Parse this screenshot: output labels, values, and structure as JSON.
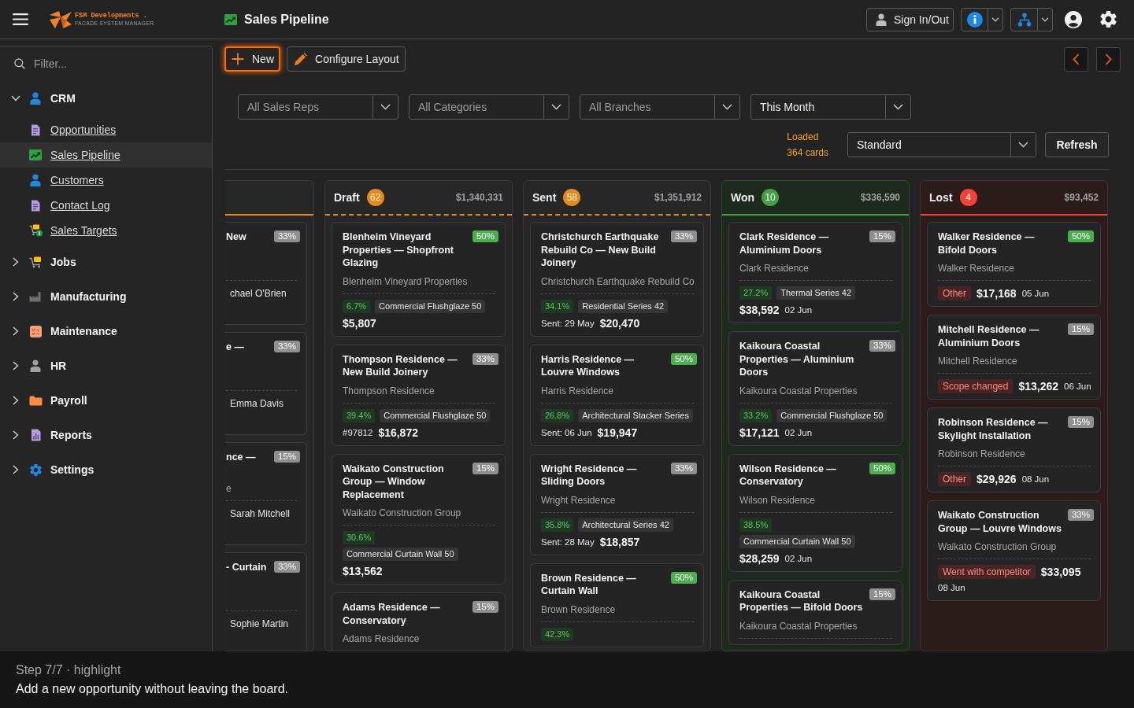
{
  "header": {
    "logo": {
      "name": "FSM Developments .",
      "tagline": "FACADE SYSTEM MANAGER"
    },
    "title": "Sales Pipeline",
    "sign_in_button": "Sign In/Out"
  },
  "sidebar": {
    "filter": {
      "placeholder": "Filter..."
    },
    "items": [
      {
        "label": "CRM",
        "expanded": true,
        "children": [
          {
            "label": "Opportunities",
            "selected": false
          },
          {
            "label": "Sales Pipeline",
            "selected": true
          },
          {
            "label": "Customers",
            "selected": false
          },
          {
            "label": "Contact Log",
            "selected": false
          },
          {
            "label": "Sales Targets",
            "selected": false
          }
        ]
      },
      {
        "label": "Jobs",
        "expanded": false
      },
      {
        "label": "Manufacturing",
        "expanded": false
      },
      {
        "label": "Maintenance",
        "expanded": false
      },
      {
        "label": "HR",
        "expanded": false
      },
      {
        "label": "Payroll",
        "expanded": false
      },
      {
        "label": "Reports",
        "expanded": false
      },
      {
        "label": "Settings",
        "expanded": false
      }
    ]
  },
  "toolbar": {
    "buttons": [
      {
        "label": "New",
        "highlighted": true
      },
      {
        "label": "Configure Layout",
        "highlighted": false
      }
    ]
  },
  "filters": [
    {
      "placeholder": "All Sales Reps"
    },
    {
      "placeholder": "All Categories"
    },
    {
      "placeholder": "All Branches"
    },
    {
      "value": "This Month"
    }
  ],
  "load_status": {
    "label": "Loaded",
    "count": "364 cards"
  },
  "view_select": {
    "value": "Standard"
  },
  "refresh_button": "Refresh",
  "board": {
    "clipped_column": {
      "cards": [
        {
          "title": "New",
          "probability": {
            "label": "33%",
            "color": "#8f8f8f"
          },
          "rep": "chael O'Brien"
        },
        {
          "title": "e —",
          "probability": {
            "label": "33%",
            "color": "#8f8f8f"
          },
          "rep": "Emma Davis"
        },
        {
          "title": "nce —",
          "probability": {
            "label": "15%",
            "color": "#8f8f8f"
          },
          "customer": "e",
          "rep": "Sarah Mitchell"
        },
        {
          "title": "- Curtain",
          "probability": {
            "label": "33%",
            "color": "#8f8f8f"
          },
          "rep": "Sophie Martin"
        }
      ]
    },
    "columns": [
      {
        "name": "Draft",
        "count": "62",
        "total": "$1,340,331",
        "kind": "open",
        "cards": [
          {
            "title": "Blenheim Vineyard Properties — Shopfront Glazing",
            "probability": {
              "label": "50%",
              "color": "#4cae4f"
            },
            "customer": "Blenheim Vineyard Properties",
            "tags": [
              {
                "kind": "margin",
                "text": "6.7%"
              },
              {
                "kind": "product",
                "text": "Commercial Flushglaze 50"
              }
            ],
            "footer": [
              {
                "kind": "value",
                "text": "$5,807"
              }
            ]
          },
          {
            "title": "Thompson Residence — New Build Joinery",
            "probability": {
              "label": "33%",
              "color": "#8f8f8f"
            },
            "customer": "Thompson Residence",
            "tags": [
              {
                "kind": "margin",
                "text": "39.4%"
              },
              {
                "kind": "product",
                "text": "Commercial Flushglaze 50"
              }
            ],
            "footer": [
              {
                "kind": "ref",
                "text": "#97812"
              },
              {
                "kind": "value",
                "text": "$16,872"
              }
            ]
          },
          {
            "title": "Waikato Construction Group — Window Replacement",
            "probability": {
              "label": "15%",
              "color": "#8f8f8f"
            },
            "customer": "Waikato Construction Group",
            "tags": [
              {
                "kind": "margin",
                "text": "30.6%"
              },
              {
                "kind": "product",
                "text": "Commercial Curtain Wall 50"
              }
            ],
            "footer": [
              {
                "kind": "value",
                "text": "$13,562"
              }
            ]
          },
          {
            "title": "Adams Residence — Conservatory",
            "probability": {
              "label": "15%",
              "color": "#8f8f8f"
            },
            "customer": "Adams Residence"
          }
        ]
      },
      {
        "name": "Sent",
        "count": "58",
        "total": "$1,351,912",
        "kind": "open",
        "cards": [
          {
            "title": "Christchurch Earthquake Rebuild Co — New Build Joinery",
            "probability": {
              "label": "33%",
              "color": "#8f8f8f"
            },
            "customer": "Christchurch Earthquake Rebuild Co",
            "tags": [
              {
                "kind": "margin",
                "text": "34.1%"
              },
              {
                "kind": "product",
                "text": "Residential Series 42"
              }
            ],
            "footer": [
              {
                "kind": "sent",
                "text": "Sent: 29 May"
              },
              {
                "kind": "value",
                "text": "$20,470"
              }
            ]
          },
          {
            "title": "Harris Residence — Louvre Windows",
            "probability": {
              "label": "50%",
              "color": "#4cae4f"
            },
            "customer": "Harris Residence",
            "tags": [
              {
                "kind": "margin",
                "text": "26.8%"
              },
              {
                "kind": "product",
                "text": "Architectural Stacker Series"
              }
            ],
            "footer": [
              {
                "kind": "sent",
                "text": "Sent: 06 Jun"
              },
              {
                "kind": "value",
                "text": "$19,947"
              }
            ]
          },
          {
            "title": "Wright Residence — Sliding Doors",
            "probability": {
              "label": "33%",
              "color": "#8f8f8f"
            },
            "customer": "Wright Residence",
            "tags": [
              {
                "kind": "margin",
                "text": "35.8%"
              },
              {
                "kind": "product",
                "text": "Architectural Series 42"
              }
            ],
            "footer": [
              {
                "kind": "sent",
                "text": "Sent: 28 May"
              },
              {
                "kind": "value",
                "text": "$18,857"
              }
            ]
          },
          {
            "title": "Brown Residence — Curtain Wall",
            "probability": {
              "label": "50%",
              "color": "#4cae4f"
            },
            "customer": "Brown Residence",
            "tags": [
              {
                "kind": "margin",
                "text": "42.3%"
              }
            ]
          }
        ]
      },
      {
        "name": "Won",
        "count": "10",
        "total": "$336,590",
        "kind": "won",
        "cards": [
          {
            "title": "Clark Residence — Aluminium Doors",
            "probability": {
              "label": "15%",
              "color": "#8f8f8f"
            },
            "customer": "Clark Residence",
            "tags": [
              {
                "kind": "margin",
                "text": "27.2%"
              },
              {
                "kind": "product",
                "text": "Thermal Series 42"
              }
            ],
            "footer": [
              {
                "kind": "value",
                "text": "$38,592"
              },
              {
                "kind": "date",
                "text": "02 Jun"
              }
            ]
          },
          {
            "title": "Kaikoura Coastal Properties — Aluminium Doors",
            "probability": {
              "label": "33%",
              "color": "#8f8f8f"
            },
            "customer": "Kaikoura Coastal Properties",
            "tags": [
              {
                "kind": "margin",
                "text": "33.2%"
              },
              {
                "kind": "product",
                "text": "Commercial Flushglaze 50"
              }
            ],
            "footer": [
              {
                "kind": "value",
                "text": "$17,121"
              },
              {
                "kind": "date",
                "text": "02 Jun"
              }
            ]
          },
          {
            "title": "Wilson Residence — Conservatory",
            "probability": {
              "label": "50%",
              "color": "#4cae4f"
            },
            "customer": "Wilson Residence",
            "tags": [
              {
                "kind": "margin",
                "text": "38.5%"
              },
              {
                "kind": "product",
                "text": "Commercial Curtain Wall 50"
              }
            ],
            "footer": [
              {
                "kind": "value",
                "text": "$28,259"
              },
              {
                "kind": "date",
                "text": "02 Jun"
              }
            ]
          },
          {
            "title": "Kaikoura Coastal Properties — Bifold Doors",
            "probability": {
              "label": "15%",
              "color": "#8f8f8f"
            },
            "customer": "Kaikoura Coastal Properties"
          }
        ]
      },
      {
        "name": "Lost",
        "count": "4",
        "total": "$93,452",
        "kind": "lost",
        "cards": [
          {
            "title": "Walker Residence — Bifold Doors",
            "probability": {
              "label": "50%",
              "color": "#4cae4f"
            },
            "customer": "Walker Residence",
            "footer": [
              {
                "kind": "reason",
                "text": "Other"
              },
              {
                "kind": "value",
                "text": "$17,168"
              },
              {
                "kind": "date",
                "text": "05 Jun"
              }
            ]
          },
          {
            "title": "Mitchell Residence — Aluminium Doors",
            "probability": {
              "label": "15%",
              "color": "#8f8f8f"
            },
            "customer": "Mitchell Residence",
            "footer": [
              {
                "kind": "reason",
                "text": "Scope changed"
              },
              {
                "kind": "value",
                "text": "$13,262"
              },
              {
                "kind": "date",
                "text": "06 Jun"
              }
            ]
          },
          {
            "title": "Robinson Residence — Skylight Installation",
            "probability": {
              "label": "15%",
              "color": "#8f8f8f"
            },
            "customer": "Robinson Residence",
            "footer": [
              {
                "kind": "reason",
                "text": "Other"
              },
              {
                "kind": "value",
                "text": "$29,926"
              },
              {
                "kind": "date",
                "text": "08 Jun"
              }
            ]
          },
          {
            "title": "Waikato Construction Group — Louvre Windows",
            "probability": {
              "label": "33%",
              "color": "#8f8f8f"
            },
            "customer": "Waikato Construction Group",
            "footer": [
              {
                "kind": "reason",
                "text": "Went with competitor"
              },
              {
                "kind": "value",
                "text": "$33,095"
              },
              {
                "kind": "date",
                "text": "08 Jun"
              }
            ]
          }
        ]
      }
    ]
  },
  "tour": {
    "step": "Step 7/7 · highlight",
    "message": "Add a new opportunity without leaving the board."
  }
}
